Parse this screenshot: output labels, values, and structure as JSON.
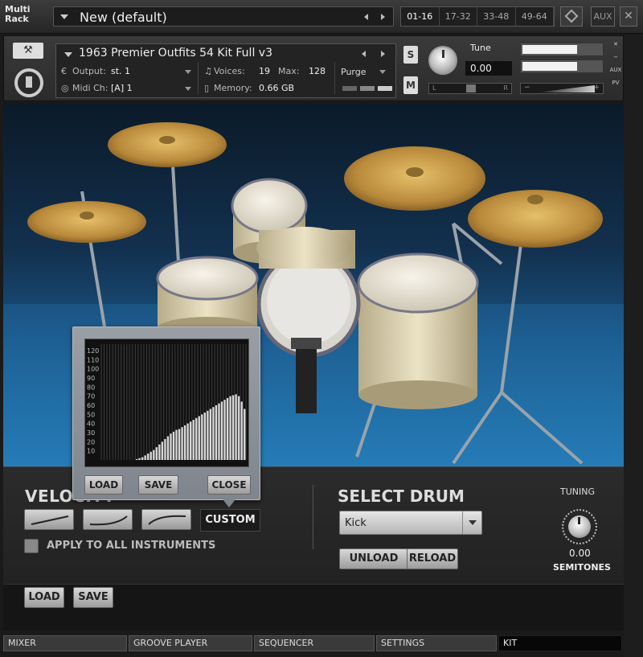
{
  "rack": {
    "label": "Multi Rack",
    "multi_name": "New (default)",
    "ranges": [
      "01-16",
      "17-32",
      "33-48",
      "49-64"
    ],
    "aux_label": "AUX",
    "close_glyph": "✕"
  },
  "instrument": {
    "title": "1963 Premier Outfits 54 Kit Full v3",
    "output_label": "Output:",
    "output_value": "st. 1",
    "voices_label": "Voices:",
    "voices_value": "19",
    "max_label": "Max:",
    "max_value": "128",
    "purge_label": "Purge",
    "midi_label": "Midi Ch:",
    "midi_value": "[A]  1",
    "memory_label": "Memory:",
    "memory_value": "0.66 GB",
    "solo_label": "S",
    "mute_label": "M",
    "tune_label": "Tune",
    "tune_value": "0.00",
    "pan_left": "L",
    "pan_right": "R",
    "vol_minus": "−",
    "vol_plus": "+",
    "side_labels": [
      "✕",
      "−",
      "AUX",
      "PV"
    ],
    "meter_levels": [
      0.68,
      0.68
    ]
  },
  "velocity_popup": {
    "y_ticks": [
      "120",
      "110",
      "100",
      "90",
      "80",
      "70",
      "60",
      "50",
      "40",
      "30",
      "20",
      "10"
    ],
    "bars": [
      0,
      0,
      0,
      0,
      0,
      0,
      0,
      0,
      0,
      0,
      0,
      0,
      1,
      2,
      3,
      5,
      7,
      9,
      11,
      14,
      17,
      20,
      23,
      26,
      29,
      31,
      33,
      34,
      36,
      38,
      40,
      42,
      44,
      46,
      48,
      50,
      52,
      54,
      56,
      58,
      60,
      62,
      64,
      66,
      68,
      70,
      71,
      72,
      70,
      64,
      56
    ],
    "load_label": "LOAD",
    "save_label": "SAVE",
    "close_label": "CLOSE"
  },
  "controls": {
    "velocity_title": "VELOCITY",
    "custom_label": "CUSTOM",
    "apply_label": "APPLY TO ALL INSTRUMENTS",
    "select_title": "SELECT DRUM",
    "drum_value": "Kick",
    "unload_label": "UNLOAD",
    "reload_label": "RELOAD",
    "tuning_label": "TUNING",
    "tuning_value": "0.00",
    "semitones_label": "SEMITONES"
  },
  "preset": {
    "load_label": "LOAD",
    "save_label": "SAVE"
  },
  "tabs": [
    "MIXER",
    "GROOVE PLAYER",
    "SEQUENCER",
    "SETTINGS",
    "KIT"
  ],
  "icons": {
    "wrench": "wrench-icon",
    "logo": "kit-logo-icon",
    "knob": "knob-icon"
  }
}
